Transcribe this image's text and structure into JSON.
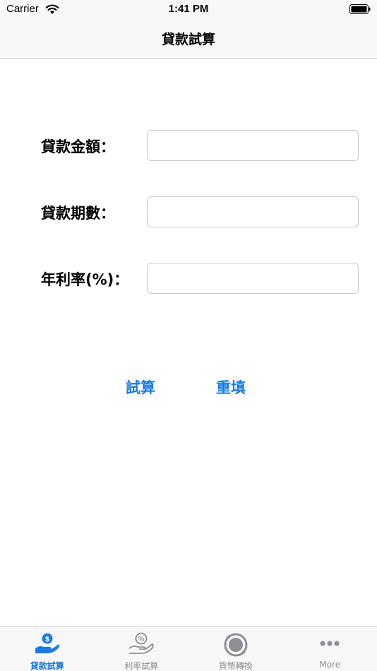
{
  "status_bar": {
    "carrier": "Carrier",
    "time": "1:41 PM"
  },
  "nav": {
    "title": "貸款試算"
  },
  "form": {
    "loan_amount_label": "貸款金額：",
    "loan_amount_value": "",
    "loan_period_label": "貸款期數：",
    "loan_period_value": "",
    "annual_rate_label": "年利率(%)：",
    "annual_rate_value": ""
  },
  "actions": {
    "calculate_label": "試算",
    "reset_label": "重填"
  },
  "tab_bar": {
    "tabs": [
      {
        "label": "貸款試算",
        "icon": "loan-hand-coin-icon",
        "active": true
      },
      {
        "label": "利率試算",
        "icon": "interest-hand-percent-icon",
        "active": false
      },
      {
        "label": "貨幣轉換",
        "icon": "currency-exchange-icon",
        "active": false
      },
      {
        "label": "More",
        "icon": "more-dots-icon",
        "active": false
      }
    ]
  },
  "colors": {
    "accent": "#1a7ce0",
    "inactive": "#8e8e93",
    "bar_background": "#f8f8f8"
  }
}
